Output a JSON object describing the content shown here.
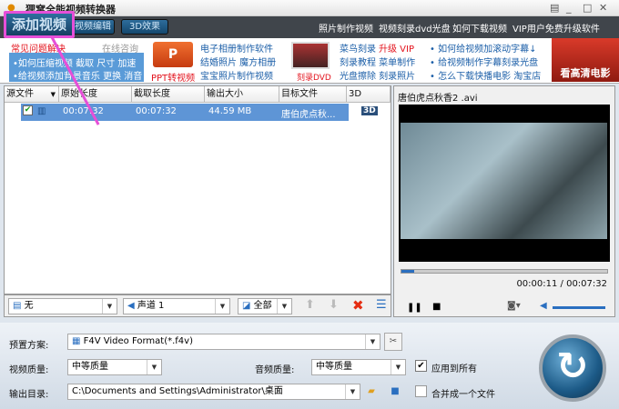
{
  "window": {
    "title": "狸窝全能视频转换器"
  },
  "toolbar": {
    "add_video": "添加视频",
    "video_edit": "视频编辑",
    "effects_3d": "3D效果",
    "links": [
      "照片制作视频",
      "视频刻录dvd光盘",
      "如何下载视频",
      "VIP用户免费升级软件"
    ]
  },
  "banner": {
    "faq_title": "常见问题解决",
    "online_consult": "在线咨询",
    "faq_links": [
      "•如何压缩视频 截取 尺寸 加速",
      "•给视频添加背景音乐 更换 消音"
    ],
    "ppt_label": "PPT转视频",
    "album_links": [
      "电子相册制作软件",
      "结婚照片 魔方相册",
      "宝宝照片制作视频"
    ],
    "dvd_label": "刻录DVD",
    "dvd_links": [
      "菜鸟刻录",
      "升级 VIP",
      "刻录教程 菜单制作",
      "光盘擦除 刻录照片"
    ],
    "tips": [
      "• 如何给视频加滚动字幕↓",
      "• 给视频制作字幕刻录光盘",
      "• 怎么下载快播电影 淘宝店"
    ],
    "hd_ad": "看高清电影"
  },
  "table": {
    "headers": [
      "源文件",
      "原始长度",
      "截取长度",
      "输出大小",
      "目标文件",
      "3D"
    ],
    "rows": [
      {
        "original": "00:07:32",
        "clip": "00:07:32",
        "size": "44.59 MB",
        "target": "唐伯虎点秋..."
      }
    ]
  },
  "player": {
    "filename": "唐伯虎点秋香2 .avi",
    "time": "00:00:11 / 00:07:32",
    "progress": 0.024,
    "volume": 0.9
  },
  "tools": {
    "subtitle": "无",
    "audio": "声道 1",
    "range": "全部"
  },
  "settings": {
    "preset_label": "预置方案:",
    "preset": "F4V Video Format(*.f4v)",
    "video_quality_label": "视频质量:",
    "video_quality": "中等质量",
    "audio_quality_label": "音频质量:",
    "audio_quality": "中等质量",
    "apply_all": "应用到所有",
    "output_label": "输出目录:",
    "output_dir": "C:\\Documents and Settings\\Administrator\\桌面",
    "merge": "合并成一个文件"
  }
}
